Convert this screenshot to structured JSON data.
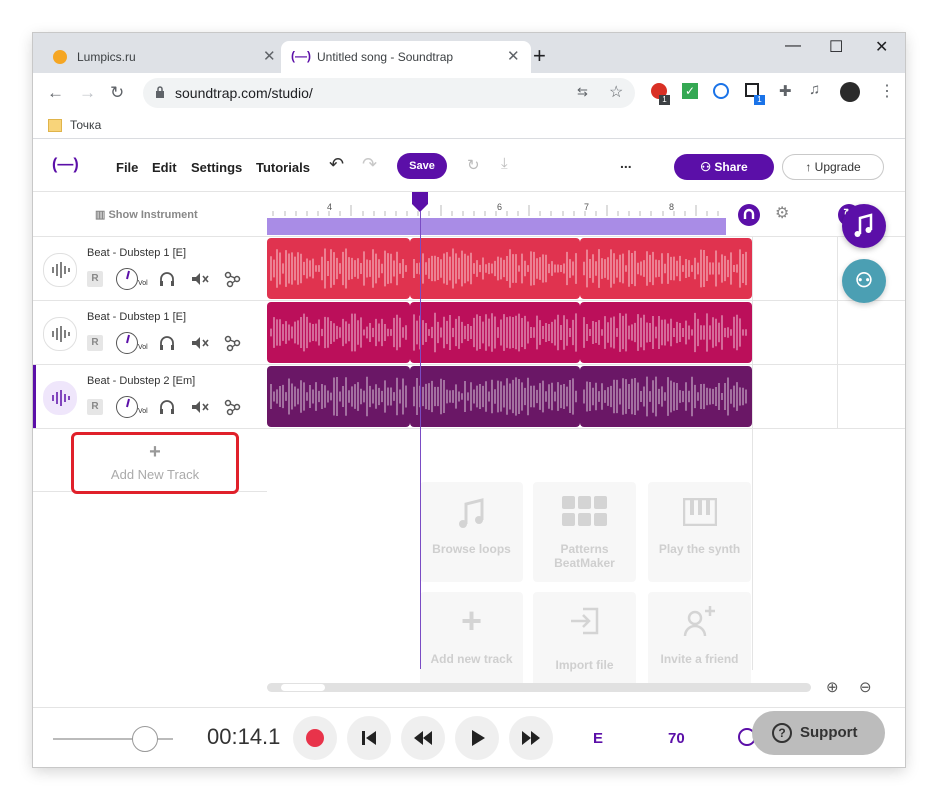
{
  "browser": {
    "tabs": [
      {
        "title": "Lumpics.ru",
        "active": false
      },
      {
        "title": "Untitled song - Soundtrap",
        "active": true
      }
    ],
    "new_tab": "+",
    "url": "soundtrap.com/studio/",
    "bookmark": "Точка",
    "extension_badges": [
      "1",
      "1"
    ]
  },
  "app": {
    "logo": "(—)",
    "menu": [
      "File",
      "Edit",
      "Settings",
      "Tutorials"
    ],
    "save_label": "Save",
    "more_label": "...",
    "share_label": "Share",
    "upgrade_label": "Upgrade",
    "show_instrument": "Show Instrument",
    "ruler_labels": [
      "4",
      "6",
      "7",
      "8"
    ],
    "tracks": [
      {
        "name": "Beat - Dubstep 1 [E]",
        "color": "#e0334f"
      },
      {
        "name": "Beat - Dubstep 1 [E]",
        "color": "#bb0f5a"
      },
      {
        "name": "Beat - Dubstep 2 [Em]",
        "color": "#6a1766"
      }
    ],
    "track_controls": {
      "record": "R",
      "volume": "Vol"
    },
    "add_track": {
      "icon": "+",
      "label": "Add New Track"
    },
    "empty_cards": [
      {
        "label": "Browse loops"
      },
      {
        "label": "Patterns BeatMaker"
      },
      {
        "label": "Play the synth"
      },
      {
        "label": "Add new track"
      },
      {
        "label": "Import file"
      },
      {
        "label": "Invite a friend"
      }
    ],
    "transport": {
      "time": "00:14.1",
      "key": "E",
      "tempo": "70",
      "support_label": "Support"
    }
  },
  "colors": {
    "brand": "#5b0fa8",
    "highlight": "#e0202a",
    "loop_bar": "#a98ce6",
    "fab_teal": "#4b9fb3"
  }
}
